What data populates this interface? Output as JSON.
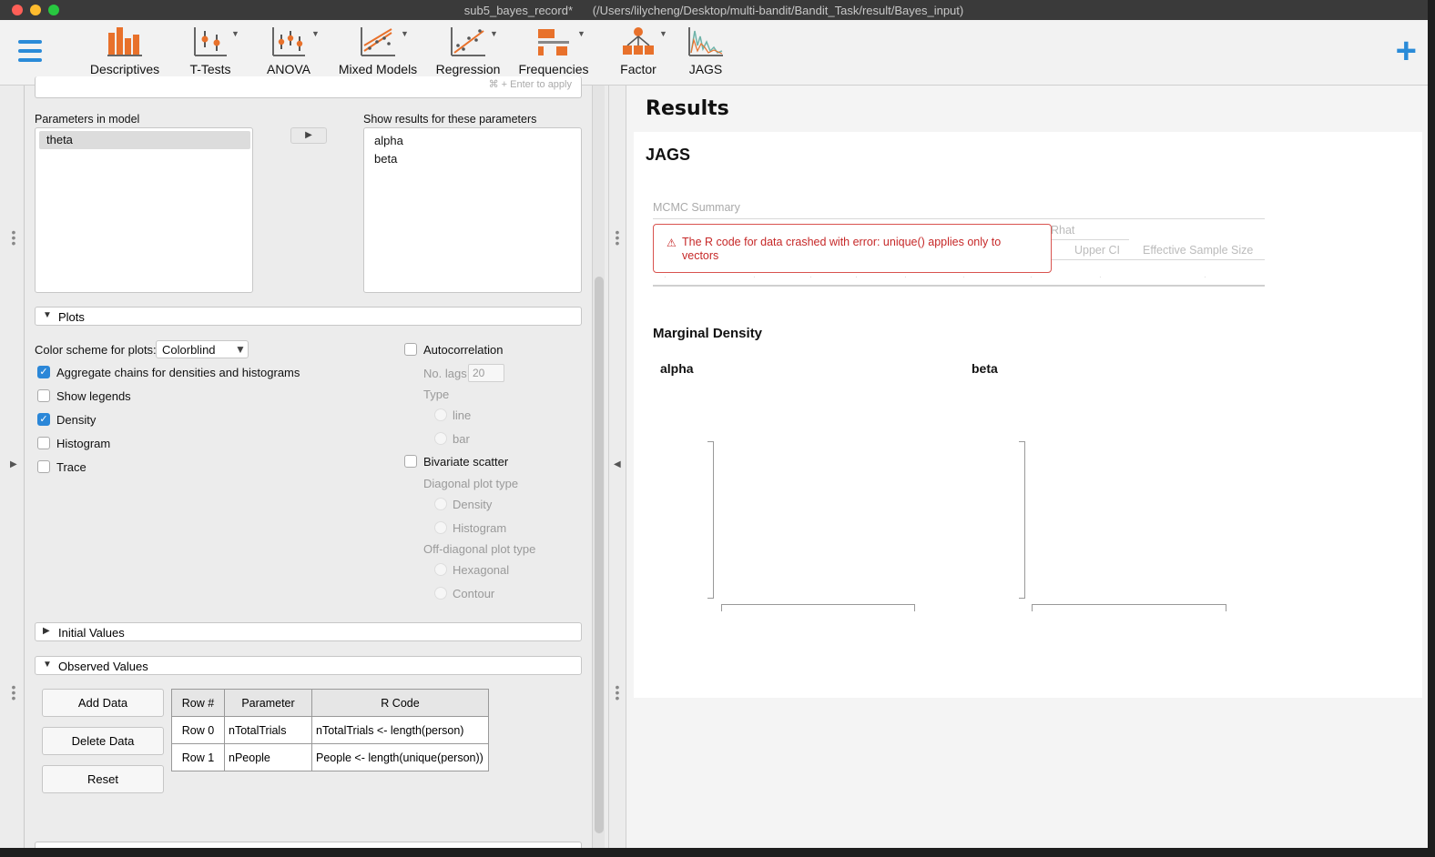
{
  "window": {
    "title": "sub5_bayes_record*      (/Users/lilycheng/Desktop/multi-bandit/Bandit_Task/result/Bayes_input)"
  },
  "toolbar": {
    "items": [
      {
        "label": "Descriptives",
        "icon": "descriptives-icon"
      },
      {
        "label": "T-Tests",
        "icon": "ttests-icon"
      },
      {
        "label": "ANOVA",
        "icon": "anova-icon"
      },
      {
        "label": "Mixed Models",
        "icon": "mixed-models-icon"
      },
      {
        "label": "Regression",
        "icon": "regression-icon"
      },
      {
        "label": "Frequencies",
        "icon": "frequencies-icon"
      },
      {
        "label": "Factor",
        "icon": "factor-icon"
      },
      {
        "label": "JAGS",
        "icon": "jags-icon"
      }
    ],
    "plus": "+"
  },
  "left": {
    "hint": "⌘ + Enter to apply",
    "params_in_model_label": "Parameters in model",
    "params_in_model": [
      "theta"
    ],
    "show_results_label": "Show results for these parameters",
    "show_results": [
      "alpha",
      "beta"
    ],
    "plots_section": "Plots",
    "color_scheme_label": "Color scheme for plots:",
    "color_scheme_value": "Colorblind",
    "aggregate_label": "Aggregate chains for densities and histograms",
    "show_legends_label": "Show legends",
    "density_label": "Density",
    "histogram_label": "Histogram",
    "trace_label": "Trace",
    "autocorrelation_label": "Autocorrelation",
    "no_lags_label": "No. lags",
    "no_lags_value": "20",
    "type_label": "Type",
    "type_line": "line",
    "type_bar": "bar",
    "bivariate_label": "Bivariate scatter",
    "diagonal_label": "Diagonal plot type",
    "diag_density": "Density",
    "diag_histogram": "Histogram",
    "offdiag_label": "Off-diagonal plot type",
    "offdiag_hexagonal": "Hexagonal",
    "offdiag_contour": "Contour",
    "initial_values_section": "Initial Values",
    "observed_values_section": "Observed Values",
    "add_data": "Add Data",
    "delete_data": "Delete Data",
    "reset": "Reset",
    "table": {
      "headers": [
        "Row #",
        "Parameter",
        "R Code"
      ],
      "rows": [
        [
          "Row 0",
          "nTotalTrials",
          "nTotalTrials <- length(person)"
        ],
        [
          "Row 1",
          "nPeople",
          "People <- length(unique(person))"
        ]
      ]
    }
  },
  "right": {
    "results_title": "Results",
    "jags_title": "JAGS",
    "mcmc_summary": "MCMC Summary",
    "col_rhat": "Rhat",
    "col_upper_ci": "Upper CI",
    "col_ess": "Effective Sample Size",
    "error_text": "The R code for data crashed with error: unique() applies only to vectors",
    "marginal_density": "Marginal Density",
    "plot_alpha": "alpha",
    "plot_beta": "beta"
  },
  "colors": {
    "accent": "#2a8bd8",
    "icon_orange": "#e8712b",
    "error_red": "#c62828",
    "checkbox_blue": "#2b87d8"
  }
}
